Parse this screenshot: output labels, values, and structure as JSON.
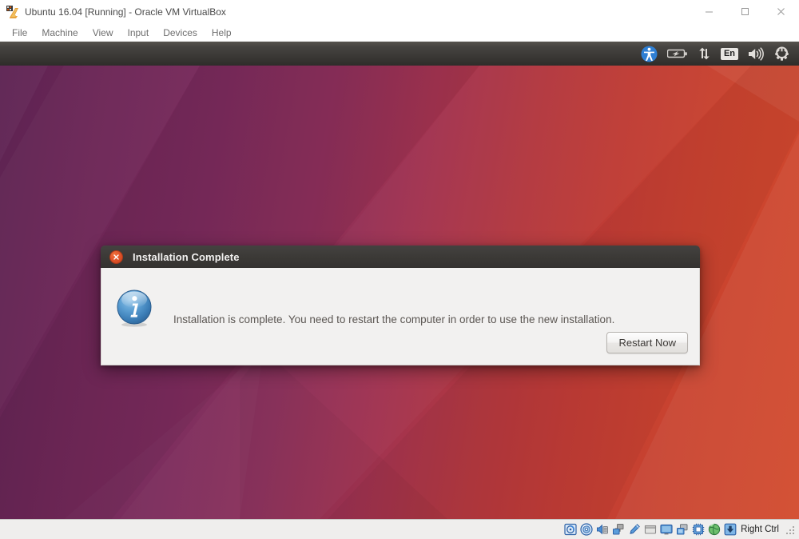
{
  "host_window": {
    "title": "Ubuntu 16.04 [Running] - Oracle VM VirtualBox",
    "logo_icon": "virtualbox-logo-icon",
    "controls": [
      {
        "name": "minimize-button",
        "icon": "minimize-icon",
        "label": "Minimize"
      },
      {
        "name": "maximize-button",
        "icon": "maximize-icon",
        "label": "Maximize"
      },
      {
        "name": "close-button",
        "icon": "close-icon",
        "label": "Close"
      }
    ]
  },
  "menubar": {
    "items": [
      {
        "label": "File"
      },
      {
        "label": "Machine"
      },
      {
        "label": "View"
      },
      {
        "label": "Input"
      },
      {
        "label": "Devices"
      },
      {
        "label": "Help"
      }
    ]
  },
  "guest": {
    "panel": {
      "indicators": [
        {
          "name": "accessibility-indicator",
          "icon": "accessibility-icon",
          "label": "Universal Access"
        },
        {
          "name": "battery-indicator",
          "icon": "battery-icon",
          "label": "Battery"
        },
        {
          "name": "network-indicator",
          "icon": "network-arrows-icon",
          "label": "Network"
        },
        {
          "name": "keyboard-indicator",
          "icon": "keyboard-layout-icon",
          "label": "En"
        },
        {
          "name": "volume-indicator",
          "icon": "speaker-icon",
          "label": "Volume"
        },
        {
          "name": "system-menu-indicator",
          "icon": "gear-power-icon",
          "label": "System"
        }
      ]
    },
    "wallpaper": {
      "name": "ubuntu-1604-suru-wallpaper",
      "color_left": "#5d2352",
      "color_mid": "#a13350",
      "color_right": "#d2492c"
    }
  },
  "dialog": {
    "title": "Installation Complete",
    "close_icon": "close-icon",
    "info_icon": "info-icon",
    "message": "Installation is complete. You need to restart the computer in order to use the new installation.",
    "primary_button": "Restart Now",
    "titlebar_color": "#3b3936",
    "body_color": "#f2f1f0"
  },
  "statusbar": {
    "icons": [
      {
        "name": "hard-disk-indicator",
        "icon": "hard-disk-icon"
      },
      {
        "name": "optical-drive-indicator",
        "icon": "optical-disk-icon"
      },
      {
        "name": "audio-indicator",
        "icon": "audio-icon"
      },
      {
        "name": "network-adapter-indicator",
        "icon": "network-icon"
      },
      {
        "name": "usb-indicator",
        "icon": "usb-icon"
      },
      {
        "name": "shared-folders-indicator",
        "icon": "folder-icon"
      },
      {
        "name": "display-indicator",
        "icon": "display-icon"
      },
      {
        "name": "video-capture-indicator",
        "icon": "video-capture-icon"
      },
      {
        "name": "cpu-indicator",
        "icon": "cpu-chip-icon"
      },
      {
        "name": "remote-desktop-indicator",
        "icon": "globe-icon"
      },
      {
        "name": "host-key-indicator",
        "icon": "host-key-icon"
      }
    ],
    "host_key": "Right Ctrl",
    "resize_grip": "resize-grip"
  }
}
